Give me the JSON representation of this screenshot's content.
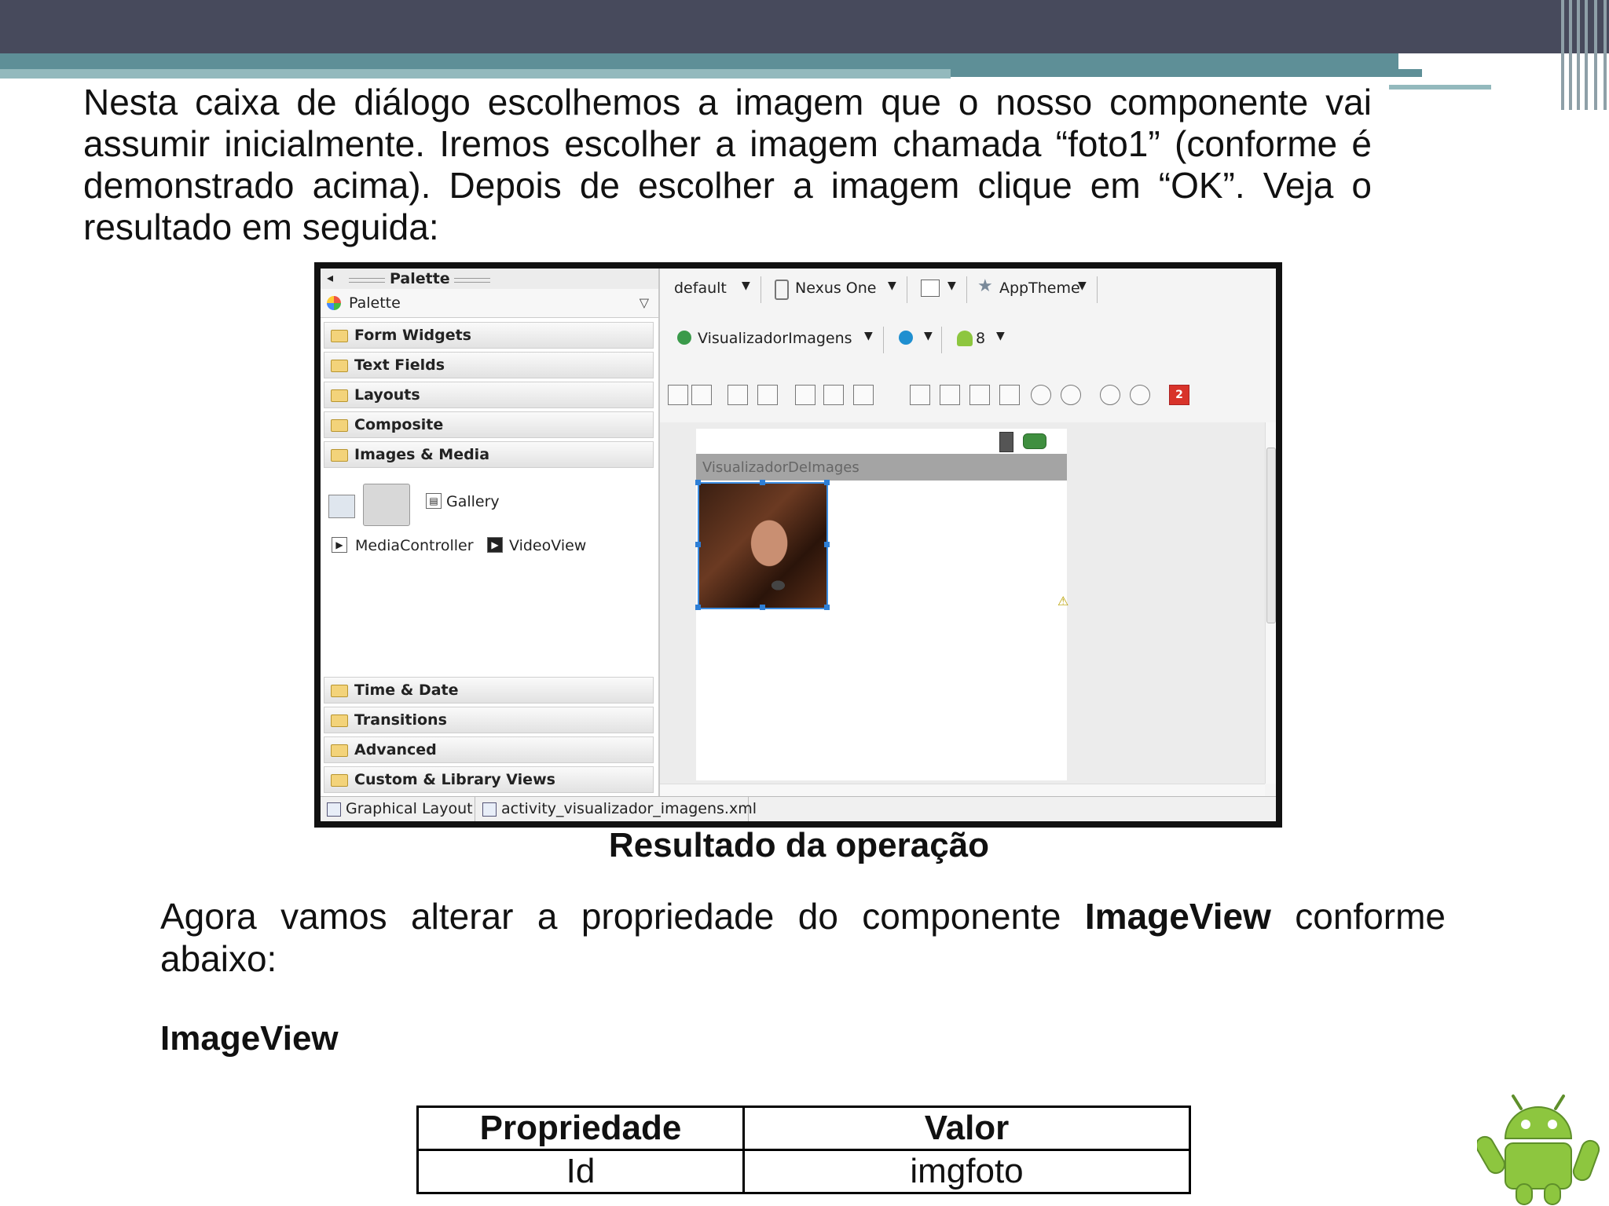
{
  "document": {
    "paragraph1": "Nesta caixa de diálogo escolhemos a imagem que o nosso componente vai assumir inicialmente. Iremos escolher a imagem chamada “foto1” (conforme é demonstrado acima). Depois de escolher a imagem clique em “OK”. Veja o resultado em seguida:",
    "caption": "Resultado da operação",
    "paragraph2_before": "Agora vamos alterar a propriedade do componente ",
    "paragraph2_bold": "ImageView",
    "paragraph2_after": " conforme abaixo:",
    "subheading": "ImageView",
    "table": {
      "headers": [
        "Propriedade",
        "Valor"
      ],
      "rows": [
        [
          "Id",
          "imgfoto"
        ]
      ]
    }
  },
  "ide": {
    "palette_title": "Palette",
    "palette_dropdown": "Palette",
    "categories_top": [
      "Form Widgets",
      "Text Fields",
      "Layouts",
      "Composite",
      "Images & Media"
    ],
    "media_items": {
      "gallery": "Gallery",
      "media_controller": "MediaController",
      "video_view": "VideoView"
    },
    "categories_bottom": [
      "Time & Date",
      "Transitions",
      "Advanced",
      "Custom & Library Views"
    ],
    "toolbar1": {
      "config": "default",
      "device": "Nexus One",
      "theme": "AppTheme"
    },
    "toolbar2": {
      "activity": "VisualizadorImagens",
      "api_level": "8"
    },
    "error_count": "2",
    "screen_title": "VisualizadorDeImages",
    "tabs": [
      "Graphical Layout",
      "activity_visualizador_imagens.xml"
    ]
  },
  "colors": {
    "topbar": "#474a5c",
    "accent_teal": "#5e8f97",
    "light_teal": "#93b9bd",
    "selection_blue": "#2e7fd6",
    "android_green": "#8dc63f"
  }
}
